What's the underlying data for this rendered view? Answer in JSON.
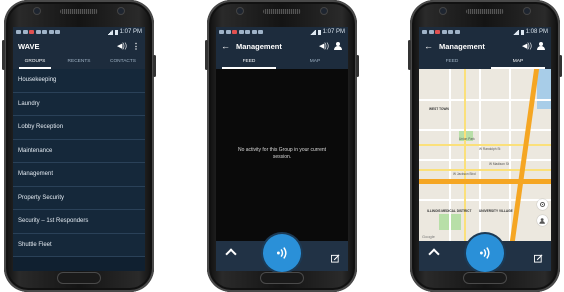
{
  "status": {
    "time_left": "1:07 PM",
    "time_mid": "1:07 PM",
    "time_right": "1:08 PM"
  },
  "phone1": {
    "title": "WAVE",
    "tabs": [
      "GROUPS",
      "RECENTS",
      "CONTACTS"
    ],
    "groups": [
      "Housekeeping",
      "Laundry",
      "Lobby Reception",
      "Maintenance",
      "Management",
      "Property Security",
      "Security – 1st Responders",
      "Shuttle Fleet"
    ]
  },
  "phone2": {
    "title": "Management",
    "tabs": [
      "FEED",
      "MAP"
    ],
    "empty_message": "No activity for this Group in your current session."
  },
  "phone3": {
    "title": "Management",
    "tabs": [
      "FEED",
      "MAP"
    ],
    "map_labels": [
      "WEST TOWN",
      "Union Park",
      "W Randolph St",
      "W Jackson Blvd",
      "W Madison St",
      "ILLINOIS MEDICAL DISTRICT",
      "UNIVERSITY VILLAGE",
      "Google"
    ]
  },
  "icons": {
    "speaker": "speaker-icon",
    "more": "more-vertical-icon",
    "back": "back-arrow-icon",
    "add_person": "add-person-icon",
    "chevron": "chevron-up-icon",
    "ptt": "push-to-talk-icon",
    "compose": "compose-icon",
    "locate": "my-location-icon"
  },
  "colors": {
    "appbar": "#1d2c3d",
    "list_bg": "#15283a",
    "accent_blue": "#2a90d8",
    "map_highway": "#f5a623"
  }
}
